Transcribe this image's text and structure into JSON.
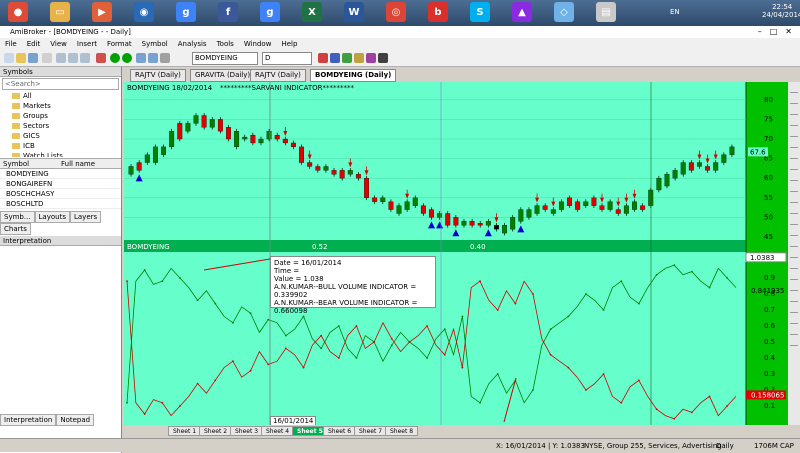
{
  "taskbar": {
    "lang": "EN",
    "time": "22:54",
    "date": "24/04/2014",
    "icons": [
      {
        "name": "chrome-taskbar-icon",
        "color": "#dd4b39",
        "label": "●"
      },
      {
        "name": "folder-taskbar-icon",
        "color": "#e8b24a",
        "label": "▭"
      },
      {
        "name": "media-taskbar-icon",
        "color": "#e0603a",
        "label": "▶"
      },
      {
        "name": "sbi-taskbar-icon",
        "color": "#2a6ab5",
        "label": "◉"
      },
      {
        "name": "google-taskbar-icon",
        "color": "#3e82f7",
        "label": "g"
      },
      {
        "name": "facebook-taskbar-icon",
        "color": "#3b5998",
        "label": "f"
      },
      {
        "name": "google2-taskbar-icon",
        "color": "#3e82f7",
        "label": "g"
      },
      {
        "name": "excel-taskbar-icon",
        "color": "#1f7244",
        "label": "X"
      },
      {
        "name": "word-taskbar-icon",
        "color": "#2b579a",
        "label": "W"
      },
      {
        "name": "chrome2-taskbar-icon",
        "color": "#db4437",
        "label": "◎"
      },
      {
        "name": "bitdefender-taskbar-icon",
        "color": "#d9302b",
        "label": "b"
      },
      {
        "name": "skype-taskbar-icon",
        "color": "#00aff0",
        "label": "S"
      },
      {
        "name": "amibroker-taskbar-icon",
        "color": "#8a2be2",
        "label": "▲"
      },
      {
        "name": "app-taskbar-icon",
        "color": "#6fb2e8",
        "label": "◇"
      },
      {
        "name": "notes-taskbar-icon",
        "color": "#c9c9c9",
        "label": "▤"
      }
    ]
  },
  "window": {
    "title": "AmiBroker - [BOMDYEING - - Daily]"
  },
  "menu": [
    "File",
    "Edit",
    "View",
    "Insert",
    "Format",
    "Symbol",
    "Analysis",
    "Tools",
    "Window",
    "Help"
  ],
  "toolbar": {
    "symbol": "BOMDYEING",
    "interval": "D"
  },
  "chart_tabs": [
    {
      "label": "RAJTV (Daily)",
      "active": false
    },
    {
      "label": "GRAVITA (Daily)",
      "active": false
    },
    {
      "label": "RAJTV (Daily)",
      "active": false
    },
    {
      "label": "BOMDYEING (Daily)",
      "active": true
    }
  ],
  "left_panel": {
    "header": "Symbols",
    "search_placeholder": "<Search>",
    "tree": [
      "All",
      "Markets",
      "Groups",
      "Sectors",
      "GICS",
      "ICB",
      "Watch Lists"
    ],
    "col_symbol": "Symbol",
    "col_fullname": "Full name",
    "symbols": [
      "BOMDYEING",
      "BONGAIREFN",
      "BOSCHCHASY",
      "BOSCHLTD"
    ],
    "bottom_tabs": [
      "Symb...",
      "Layouts",
      "Layers",
      "Charts"
    ],
    "interp_header": "Interpretation",
    "interp_tabs": [
      "Interpretation",
      "Notepad"
    ]
  },
  "price_pane": {
    "header": "BOMDYEING 18/02/2014",
    "subheader": "*********SARVANI INDICATOR*********",
    "last_price": "67.6",
    "ticks": [
      "80",
      "75",
      "70",
      "65",
      "60",
      "55",
      "50",
      "45"
    ]
  },
  "ind_pane": {
    "header": "BOMDYEING",
    "val1": "0.52",
    "val2": "0.40",
    "last1": "1.0383",
    "last2": "0.841935",
    "last3": "0.158065",
    "ticks": [
      "0.9",
      "0.8",
      "0.7",
      "0.6",
      "0.5",
      "0.4",
      "0.3",
      "0.2",
      "0.1"
    ]
  },
  "tooltip": {
    "line1": "Date = 16/01/2014",
    "line2": "Time =",
    "line3": "Value = 1.038",
    "line4": "A.N.KUMAR--BULL VOLUME INDICATOR = 0.339902",
    "line5": "A.N.KUMAR--BEAR VOLUME INDICATOR = 0.660098"
  },
  "cross_date": "16/01/2014",
  "sheets": [
    {
      "label": "Sheet 1",
      "active": false
    },
    {
      "label": "Sheet 2",
      "active": false
    },
    {
      "label": "Sheet 3",
      "active": false
    },
    {
      "label": "Sheet 4",
      "active": false
    },
    {
      "label": "Sheet 5",
      "active": true
    },
    {
      "label": "Sheet 6",
      "active": false
    },
    {
      "label": "Sheet 7",
      "active": false
    },
    {
      "label": "Sheet 8",
      "active": false
    }
  ],
  "status": {
    "pos": "X: 16/01/2014 | Y: 1.0383",
    "info": "NYSE, Group 255, Services, Advertising",
    "disk": "Daily",
    "mem": "1706M",
    "cap": "CAP"
  },
  "chart_data": [
    {
      "type": "candlestick",
      "ylim": [
        45,
        82
      ],
      "candles": [
        [
          61,
          63
        ],
        [
          62,
          64
        ],
        [
          64,
          66
        ],
        [
          64,
          68
        ],
        [
          66,
          68
        ],
        [
          68,
          72
        ],
        [
          70,
          74
        ],
        [
          72,
          74
        ],
        [
          74,
          76
        ],
        [
          73,
          76
        ],
        [
          73,
          75
        ],
        [
          72,
          75
        ],
        [
          70,
          73
        ],
        [
          68,
          72
        ],
        [
          70,
          70.5
        ],
        [
          69,
          71
        ],
        [
          69,
          70
        ],
        [
          70,
          72
        ],
        [
          70,
          71
        ],
        [
          69,
          70
        ],
        [
          68,
          69
        ],
        [
          64,
          68
        ],
        [
          63,
          64
        ],
        [
          62,
          63
        ],
        [
          62,
          63
        ],
        [
          61,
          62
        ],
        [
          60,
          62
        ],
        [
          61,
          62
        ],
        [
          60,
          61
        ],
        [
          55,
          60
        ],
        [
          54,
          55
        ],
        [
          54,
          55
        ],
        [
          52,
          54
        ],
        [
          51,
          53
        ],
        [
          52,
          54
        ],
        [
          53,
          55
        ],
        [
          51,
          53
        ],
        [
          50,
          52
        ],
        [
          50,
          51
        ],
        [
          48,
          51
        ],
        [
          48,
          50
        ],
        [
          48,
          49
        ],
        [
          48,
          49
        ],
        [
          48,
          48.5
        ],
        [
          48,
          49
        ],
        [
          47,
          48
        ],
        [
          46,
          48
        ],
        [
          47,
          50
        ],
        [
          49,
          52
        ],
        [
          50,
          52
        ],
        [
          51,
          53
        ],
        [
          52,
          53
        ],
        [
          51,
          52
        ],
        [
          52,
          54
        ],
        [
          53,
          55
        ],
        [
          52,
          54
        ],
        [
          53,
          54
        ],
        [
          53,
          55
        ],
        [
          52,
          53
        ],
        [
          52,
          54
        ],
        [
          51,
          52
        ],
        [
          51,
          53
        ],
        [
          52,
          54
        ],
        [
          52,
          53
        ],
        [
          53,
          57
        ],
        [
          57,
          60
        ],
        [
          58,
          61
        ],
        [
          60,
          62
        ],
        [
          61,
          64
        ],
        [
          62,
          64
        ],
        [
          63,
          64
        ],
        [
          62,
          63
        ],
        [
          62,
          64
        ],
        [
          64,
          66
        ],
        [
          66,
          68
        ]
      ],
      "bull": [
        1,
        0,
        1,
        1,
        1,
        1,
        0,
        1,
        1,
        0,
        1,
        0,
        0,
        1,
        1,
        0,
        1,
        1,
        0,
        0,
        0,
        0,
        0,
        0,
        1,
        0,
        0,
        1,
        0,
        0,
        0,
        1,
        0,
        1,
        1,
        1,
        0,
        0,
        1,
        0,
        0,
        1,
        0,
        0,
        1,
        0,
        1,
        1,
        1,
        1,
        1,
        0,
        1,
        1,
        0,
        0,
        1,
        0,
        0,
        1,
        0,
        1,
        1,
        0,
        1,
        1,
        1,
        1,
        1,
        0,
        1,
        0,
        1,
        1,
        1
      ],
      "down_arrows": [
        19,
        22,
        27,
        29,
        34,
        45,
        50,
        52,
        58,
        60,
        61,
        62,
        70,
        71,
        72
      ],
      "up_arrows": [
        1,
        37,
        38,
        40,
        44,
        48
      ]
    },
    {
      "type": "line",
      "ylim": [
        0,
        1.05
      ],
      "series": [
        {
          "color": "#008000",
          "values": [
            0.12,
            0.88,
            0.95,
            0.86,
            0.88,
            0.96,
            0.9,
            0.84,
            0.76,
            0.82,
            0.74,
            0.66,
            0.62,
            0.72,
            0.68,
            0.56,
            0.64,
            0.62,
            0.54,
            0.58,
            0.66,
            0.52,
            0.46,
            0.56,
            0.6,
            0.46,
            0.4,
            0.54,
            0.5,
            0.38,
            0.48,
            0.56,
            0.5,
            0.46,
            0.4,
            0.52,
            0.58,
            0.42,
            0.66,
            0.16,
            0.12,
            0.24,
            0.3,
            0.18,
            0.26,
            0.12,
            0.2,
            0.48,
            0.58,
            0.62,
            0.66,
            0.72,
            0.8,
            0.76,
            0.7,
            0.84,
            0.88,
            0.78,
            0.74,
            0.84,
            0.92,
            0.96,
            0.98,
            0.92,
            0.94,
            0.88,
            0.84,
            0.96,
            0.9,
            0.84
          ]
        },
        {
          "color": "#d00000",
          "values": [
            0.88,
            0.12,
            0.05,
            0.14,
            0.12,
            0.04,
            0.1,
            0.16,
            0.24,
            0.18,
            0.26,
            0.34,
            0.38,
            0.28,
            0.32,
            0.44,
            0.36,
            0.38,
            0.46,
            0.42,
            0.34,
            0.48,
            0.54,
            0.44,
            0.4,
            0.54,
            0.6,
            0.46,
            0.5,
            0.62,
            0.52,
            0.44,
            0.5,
            0.54,
            0.6,
            0.48,
            0.42,
            0.58,
            0.34,
            0.84,
            0.88,
            0.76,
            0.7,
            0.82,
            0.74,
            0.88,
            0.8,
            0.52,
            0.42,
            0.38,
            0.34,
            0.28,
            0.2,
            0.24,
            0.3,
            0.16,
            0.12,
            0.22,
            0.26,
            0.16,
            0.08,
            0.04,
            0.02,
            0.08,
            0.06,
            0.12,
            0.16,
            0.04,
            0.1,
            0.16
          ]
        }
      ]
    }
  ]
}
